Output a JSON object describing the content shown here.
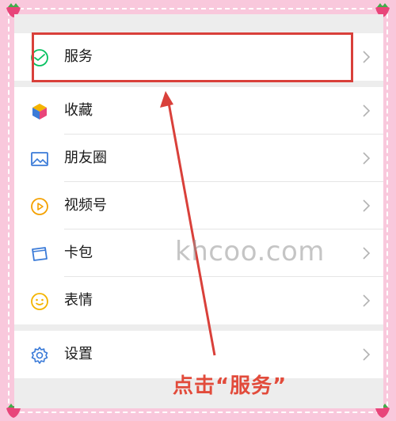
{
  "menu": {
    "top_group": [
      {
        "label": "服务",
        "icon": "wechat-pay-icon"
      }
    ],
    "middle_group": [
      {
        "label": "收藏",
        "icon": "cube-icon"
      },
      {
        "label": "朋友圈",
        "icon": "image-icon"
      },
      {
        "label": "视频号",
        "icon": "play-circle-icon"
      },
      {
        "label": "卡包",
        "icon": "card-icon"
      },
      {
        "label": "表情",
        "icon": "smiley-icon"
      }
    ],
    "bottom_group": [
      {
        "label": "设置",
        "icon": "gear-icon"
      }
    ]
  },
  "annotation": {
    "caption": "点击“服务”",
    "watermark": "khcoo.com",
    "color": "#d9403a"
  },
  "colors": {
    "frame": "#f9c8dc",
    "green": "#07c160",
    "blue": "#3b7bd8",
    "yellow": "#f4b400"
  }
}
